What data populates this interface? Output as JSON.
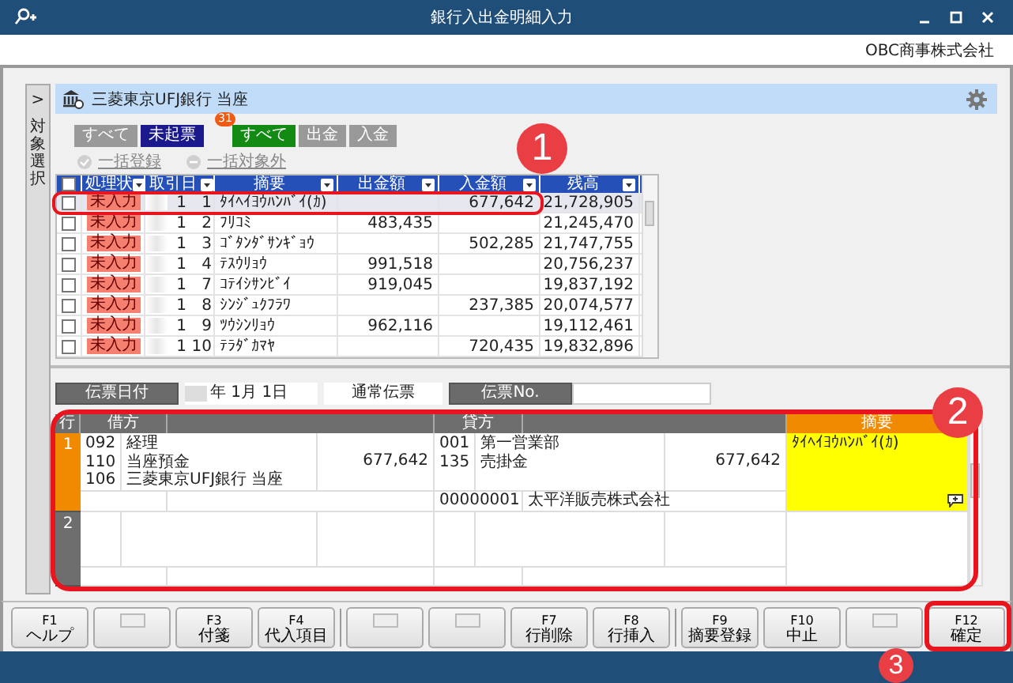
{
  "window": {
    "title": "銀行入出金明細入力"
  },
  "company": "OBC商事株式会社",
  "side_tab": {
    "arrow": ">",
    "label": "対象選択"
  },
  "account": {
    "name": "三菱東京UFJ銀行 当座"
  },
  "status_filters": [
    {
      "label": "すべて",
      "selected": false
    },
    {
      "label": "未起票",
      "selected": true,
      "badge": "31"
    }
  ],
  "type_filters": [
    {
      "label": "すべて",
      "selected": true
    },
    {
      "label": "出金",
      "selected": false
    },
    {
      "label": "入金",
      "selected": false
    }
  ],
  "bulk_actions": [
    {
      "label": "一括登録",
      "disabled": true
    },
    {
      "label": "一括対象外",
      "disabled": true
    }
  ],
  "table": {
    "all_checked": false,
    "columns": [
      "処理状",
      "取引日",
      "摘要",
      "出金額",
      "入金額",
      "残高"
    ],
    "rows": [
      {
        "checked": false,
        "selected": true,
        "status": "未入力",
        "month": "1",
        "day": "1",
        "description": "ﾀｲﾍｲﾖｳﾊﾝﾊﾞｲ(ｶ)",
        "deposit": "677,642",
        "balance": "21,728,905"
      },
      {
        "checked": false,
        "selected": false,
        "status": "未入力",
        "month": "1",
        "day": "2",
        "description": "ﾌﾘｺﾐ",
        "withdrawal": "483,435",
        "balance": "21,245,470"
      },
      {
        "checked": false,
        "selected": false,
        "status": "未入力",
        "month": "1",
        "day": "3",
        "description": "ｺﾞﾀﾝﾀﾞｻﾝｷﾞｮｳ",
        "deposit": "502,285",
        "balance": "21,747,755"
      },
      {
        "checked": false,
        "selected": false,
        "status": "未入力",
        "month": "1",
        "day": "4",
        "description": "ﾃｽｳﾘｮｳ",
        "withdrawal": "991,518",
        "balance": "20,756,237"
      },
      {
        "checked": false,
        "selected": false,
        "status": "未入力",
        "month": "1",
        "day": "7",
        "description": "ｺﾃｲｼｻﾝﾋﾞｲ",
        "withdrawal": "919,045",
        "balance": "19,837,192"
      },
      {
        "checked": false,
        "selected": false,
        "status": "未入力",
        "month": "1",
        "day": "8",
        "description": "ｼﾝｼﾞｭｸﾌﾗﾜ",
        "deposit": "237,385",
        "balance": "20,074,577"
      },
      {
        "checked": false,
        "selected": false,
        "status": "未入力",
        "month": "1",
        "day": "9",
        "description": "ﾂｳｼﾝﾘｮｳ",
        "withdrawal": "962,116",
        "balance": "19,112,461"
      },
      {
        "checked": false,
        "selected": false,
        "status": "未入力",
        "month": "1",
        "day": "10",
        "description": "ﾃﾗﾀﾞｶﾏﾔ",
        "deposit": "720,435",
        "balance": "19,832,896"
      }
    ]
  },
  "voucher": {
    "date_label": "伝票日付",
    "date": "年  1月  1日",
    "type": "通常伝票",
    "number_label": "伝票No."
  },
  "journal": {
    "columns": [
      "行",
      "借方",
      "貸方",
      "摘要"
    ],
    "rows": [
      {
        "number": "1",
        "selected": true,
        "debit": {
          "lines": [
            {
              "code": "092",
              "name": "経理"
            },
            {
              "code": "110",
              "name": "当座預金"
            },
            {
              "code": "106",
              "name": "三菱東京UFJ銀行 当座"
            }
          ],
          "amount": "677,642"
        },
        "credit": {
          "lines": [
            {
              "code": "001",
              "name": "第一営業部"
            },
            {
              "code": "135",
              "name": "売掛金"
            }
          ],
          "amount": "677,642",
          "sub_code": "00000001",
          "sub_name": "太平洋販売株式会社"
        },
        "memo": "ﾀｲﾍｲﾖｳﾊﾝﾊﾞｲ(ｶ)"
      },
      {
        "number": "2",
        "selected": false
      }
    ]
  },
  "function_keys": [
    {
      "kind": "key",
      "key": "F1",
      "label": "ヘルプ"
    },
    {
      "kind": "blank"
    },
    {
      "kind": "key",
      "key": "F3",
      "label": "付箋"
    },
    {
      "kind": "key",
      "key": "F4",
      "label": "代入項目"
    },
    {
      "kind": "blank"
    },
    {
      "kind": "blank"
    },
    {
      "kind": "key",
      "key": "F7",
      "label": "行削除"
    },
    {
      "kind": "key",
      "key": "F8",
      "label": "行挿入"
    },
    {
      "kind": "key",
      "key": "F9",
      "label": "摘要登録"
    },
    {
      "kind": "key",
      "key": "F10",
      "label": "中止"
    },
    {
      "kind": "blank"
    },
    {
      "kind": "key",
      "key": "F12",
      "label": "確定"
    }
  ],
  "callouts": [
    "1",
    "2",
    "3"
  ]
}
